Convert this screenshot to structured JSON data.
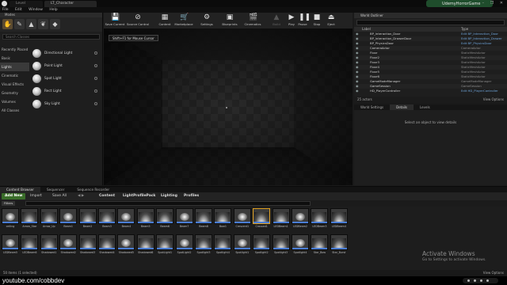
{
  "titlebar": {
    "tabs": [
      {
        "label": "Level"
      },
      {
        "label": "LT_Character"
      }
    ],
    "project_name": "UdemyHorrorGame",
    "window_controls": "– ❐ ✕"
  },
  "menubar": {
    "items": [
      "File",
      "Edit",
      "Window",
      "Help"
    ]
  },
  "modes": {
    "title": "Modes",
    "search_placeholder": "Search Classes",
    "categories": [
      "Recently Placed",
      "Basic",
      "Lights",
      "Cinematic",
      "Visual Effects",
      "Geometry",
      "Volumes",
      "All Classes"
    ],
    "active_category": "Lights",
    "items": [
      "Directional Light",
      "Point Light",
      "Spot Light",
      "Rect Light",
      "Sky Light"
    ]
  },
  "toolbar": {
    "buttons": [
      {
        "label": "Save Current",
        "icon": "save-icon",
        "glyph": "💾"
      },
      {
        "label": "Source Control",
        "icon": "source-control-icon",
        "glyph": "⊘"
      },
      {
        "label": "Content",
        "icon": "content-icon",
        "glyph": "▦"
      },
      {
        "label": "Marketplace",
        "icon": "marketplace-icon",
        "glyph": "🛒"
      },
      {
        "label": "Settings",
        "icon": "settings-icon",
        "glyph": "⚙"
      },
      {
        "label": "Blueprints",
        "icon": "blueprints-icon",
        "glyph": "▣"
      },
      {
        "label": "Cinematics",
        "icon": "cinematics-icon",
        "glyph": "🎬"
      },
      {
        "label": "Build",
        "icon": "build-icon",
        "glyph": "▲"
      },
      {
        "label": "Play",
        "icon": "play-icon",
        "glyph": "▶"
      },
      {
        "label": "Pause",
        "icon": "pause-icon",
        "glyph": "❚❚"
      },
      {
        "label": "Stop",
        "icon": "stop-icon",
        "glyph": "■"
      },
      {
        "label": "Eject",
        "icon": "eject-icon",
        "glyph": "⏏"
      }
    ]
  },
  "viewport": {
    "mouse_control_hint": "Shift+F1 for Mouse Cursor"
  },
  "outliner": {
    "title": "World Outliner",
    "col_label": "Label",
    "col_type": "Type",
    "rows": [
      {
        "name": "BP_Interaction_Door",
        "type": "Edit BP_Interaction_Door",
        "link": true
      },
      {
        "name": "BP_Interaction_DrawerDoor",
        "type": "Edit BP_Interaction_Drawer",
        "link": true
      },
      {
        "name": "BP_PhysicsDoor",
        "type": "Edit BP_PhysicsDoor",
        "link": true
      },
      {
        "name": "CameraActor",
        "type": "CameraActor",
        "link": false
      },
      {
        "name": "Floor",
        "type": "StaticMeshActor",
        "link": false
      },
      {
        "name": "Floor2",
        "type": "StaticMeshActor",
        "link": false
      },
      {
        "name": "Floor3",
        "type": "StaticMeshActor",
        "link": false
      },
      {
        "name": "Floor4",
        "type": "StaticMeshActor",
        "link": false
      },
      {
        "name": "Floor5",
        "type": "StaticMeshActor",
        "link": false
      },
      {
        "name": "Floor6",
        "type": "StaticMeshActor",
        "link": false
      },
      {
        "name": "GameModeManager",
        "type": "GameModeManager",
        "link": false
      },
      {
        "name": "GameSession",
        "type": "GameSession",
        "link": false
      },
      {
        "name": "HD_PlayerController",
        "type": "Edit HD_PlayerController",
        "link": true
      }
    ],
    "count_text": "25 actors",
    "view_options": "View Options"
  },
  "details": {
    "tabs": [
      "World Settings",
      "Details",
      "Levels"
    ],
    "empty_message": "Select an object to view details"
  },
  "content_browser": {
    "tabs": [
      "Content Browser",
      "Sequencer",
      "Sequence Recorder"
    ],
    "add_new": "Add New",
    "import": "Import",
    "save_all": "Save All",
    "breadcrumbs": [
      "Content",
      "LightProfilePack",
      "Lighting",
      "Profiles"
    ],
    "filters": "Filters",
    "assets_row1": [
      "ceiling",
      "Arrow_Star",
      "Arrow_Up",
      "Beam1",
      "Beam2",
      "Beam3",
      "Beam4",
      "Beam5",
      "Beam6",
      "Beam7",
      "Beam8",
      "Bow1",
      "Crescent1",
      "Crossed1",
      "LEDBeam1",
      "LEDBeam2",
      "LEDBeam3",
      "LEDBeam4"
    ],
    "assets_row2": [
      "LEDBeam5",
      "LEDBeam6",
      "Shadowed1",
      "Shadowed2",
      "Shadowed3",
      "Shadowed4",
      "Shadowed5",
      "Shadowed6",
      "SpotLight1",
      "SpotLight2",
      "Spotlight3",
      "Spotlight4",
      "Spotlight1",
      "Spotlight2",
      "Spotlight3",
      "Spotlight4",
      "Star_Bow",
      "Star_Burst"
    ],
    "selected_asset": "Crossed1",
    "footer_count": "50 items (1 selected)",
    "view_options": "View Options"
  },
  "watermark": {
    "line1": "Activate Windows",
    "line2": "Go to Settings to activate Windows."
  },
  "bottom_caption": "youtube.com/cobbdev",
  "accent_colors": {
    "project_badge": "#1f4d2c",
    "add_new": "#3a6e2a",
    "link": "#6ea3d8",
    "selection": "#e0a020"
  }
}
